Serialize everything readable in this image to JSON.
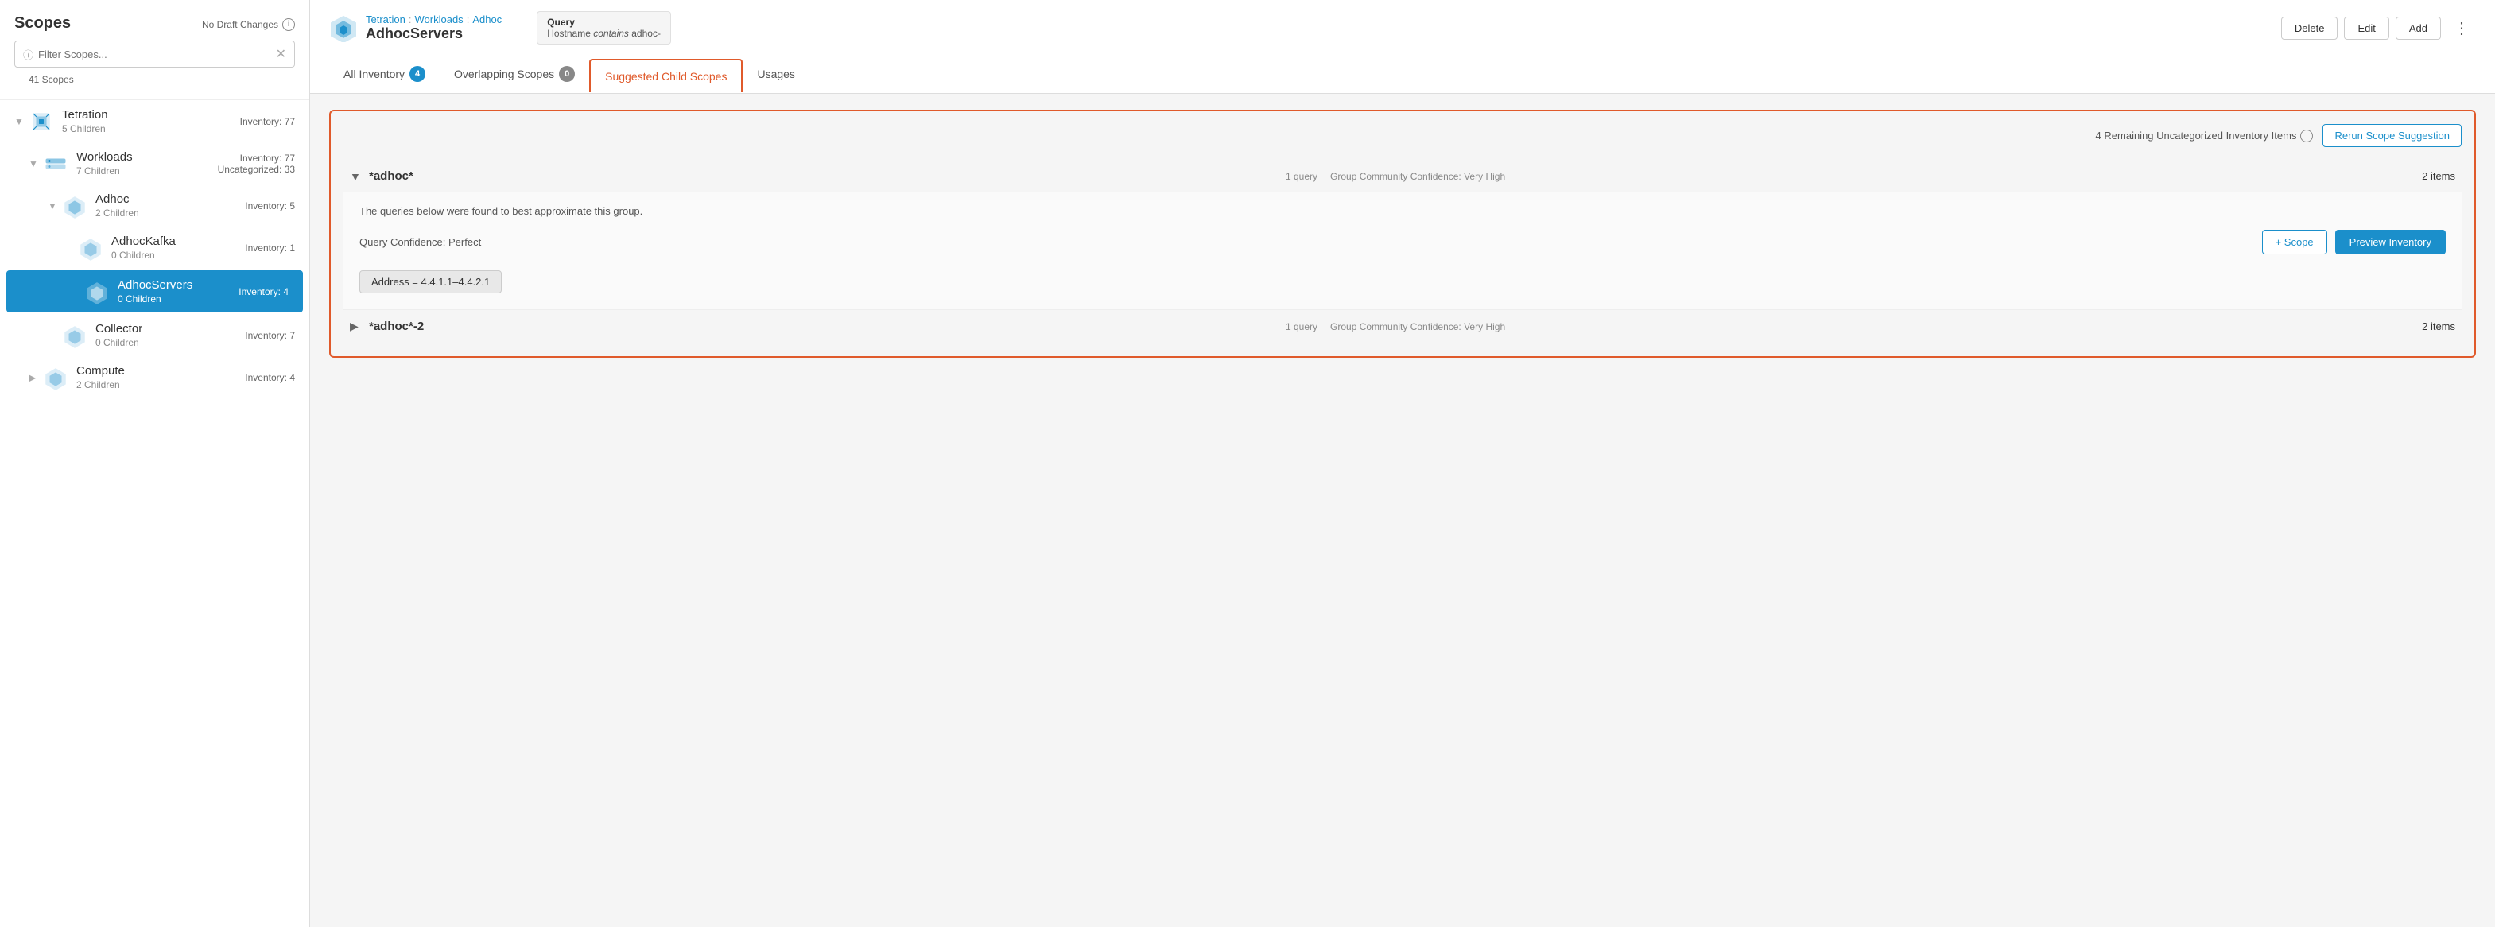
{
  "sidebar": {
    "title": "Scopes",
    "draft_notice": "No Draft Changes",
    "search_placeholder": "Filter Scopes...",
    "scope_count": "41 Scopes",
    "scopes": [
      {
        "id": "tetration",
        "name": "Tetration",
        "children_count": "5 Children",
        "inventory": "Inventory: 77",
        "indent": 0,
        "expanded": true,
        "icon": "cube"
      },
      {
        "id": "workloads",
        "name": "Workloads",
        "children_count": "7 Children",
        "inventory": "Inventory: 77",
        "uncategorized": "Uncategorized: 33",
        "indent": 1,
        "expanded": true,
        "icon": "stack"
      },
      {
        "id": "adhoc",
        "name": "Adhoc",
        "children_count": "2 Children",
        "inventory": "Inventory: 5",
        "indent": 2,
        "expanded": true,
        "icon": "cube-small"
      },
      {
        "id": "adhockafka",
        "name": "AdhocKafka",
        "children_count": "0 Children",
        "inventory": "Inventory: 1",
        "indent": 3,
        "icon": "cube-small"
      },
      {
        "id": "adhocservers",
        "name": "AdhocServers",
        "children_count": "0 Children",
        "inventory": "Inventory: 4",
        "indent": 3,
        "active": true,
        "icon": "cube-small"
      },
      {
        "id": "collector",
        "name": "Collector",
        "children_count": "0 Children",
        "inventory": "Inventory: 7",
        "indent": 2,
        "icon": "cube-small"
      },
      {
        "id": "compute",
        "name": "Compute",
        "children_count": "2 Children",
        "inventory": "Inventory: 4",
        "indent": 1,
        "icon": "cube-small",
        "has_right_chevron": true
      }
    ]
  },
  "header": {
    "breadcrumb": [
      "Tetration",
      "Workloads",
      "Adhoc"
    ],
    "scope_name": "AdhocServers",
    "query_label": "Query",
    "query_text": "Hostname contains adhoc-",
    "query_contains_keyword": "contains",
    "buttons": {
      "delete": "Delete",
      "edit": "Edit",
      "add": "Add"
    }
  },
  "tabs": [
    {
      "id": "all-inventory",
      "label": "All Inventory",
      "badge": "4",
      "badge_zero": false
    },
    {
      "id": "overlapping-scopes",
      "label": "Overlapping Scopes",
      "badge": "0",
      "badge_zero": true
    },
    {
      "id": "suggested-child-scopes",
      "label": "Suggested Child Scopes",
      "active": true
    },
    {
      "id": "usages",
      "label": "Usages"
    }
  ],
  "suggested": {
    "remaining_text": "4 Remaining Uncategorized Inventory Items",
    "rerun_btn": "Rerun Scope Suggestion",
    "items": [
      {
        "id": "adhoc-star",
        "name": "*adhoc*",
        "query_count": "1 query",
        "confidence": "Group Community Confidence: Very High",
        "items_count": "2 items",
        "expanded": true,
        "description": "The queries below were found to best approximate this group.",
        "query_confidence": "Query Confidence: Perfect",
        "query_tag": "Address = 4.4.1.1–4.4.2.1",
        "add_scope_label": "+ Scope",
        "preview_label": "Preview Inventory"
      },
      {
        "id": "adhoc-star-2",
        "name": "*adhoc*-2",
        "query_count": "1 query",
        "confidence": "Group Community Confidence: Very High",
        "items_count": "2 items",
        "expanded": false
      }
    ]
  }
}
